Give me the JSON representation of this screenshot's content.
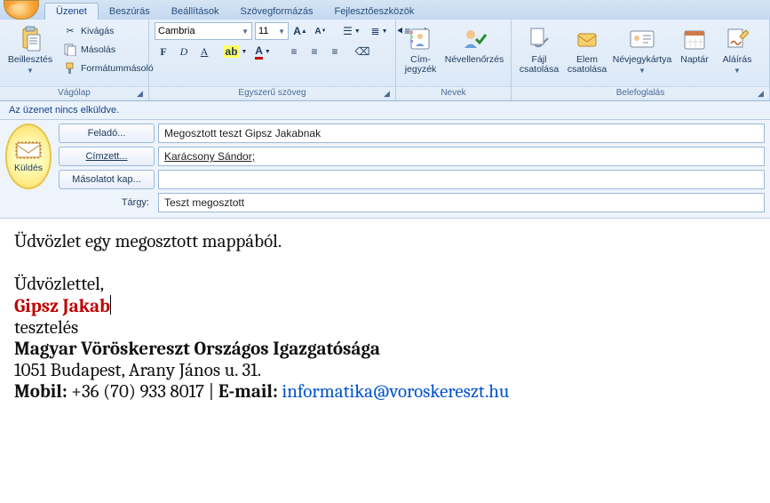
{
  "tabs": {
    "message": "Üzenet",
    "insert": "Beszúrás",
    "options": "Beállítások",
    "format": "Szövegformázás",
    "developer": "Fejlesztőeszközök"
  },
  "ribbon": {
    "clipboard": {
      "title": "Vágólap",
      "paste": "Beillesztés",
      "cut": "Kivágás",
      "copy": "Másolás",
      "format_painter": "Formátummásoló"
    },
    "basictext": {
      "title": "Egyszerű szöveg",
      "font_name": "Cambria",
      "font_size": "11"
    },
    "names": {
      "title": "Nevek",
      "address_book": "Cím-jegyzék",
      "check_names": "Névellenőrzés"
    },
    "include": {
      "title": "Belefoglalás",
      "attach_file": "Fájl csatolása",
      "attach_item": "Elem csatolása",
      "business_card": "Névjegykártya",
      "calendar": "Naptár",
      "signature": "Aláírás"
    }
  },
  "info_bar": "Az üzenet nincs elküldve.",
  "header": {
    "send": "Küldés",
    "from_btn": "Feladó...",
    "from_value": "Megosztott teszt Gipsz Jakabnak",
    "to_btn": "Címzett...",
    "to_value": "Karácsony Sándor;",
    "cc_btn": "Másolatot kap...",
    "cc_value": "",
    "subject_label": "Tárgy:",
    "subject_value": "Teszt megosztott"
  },
  "body": {
    "greeting": "Üdvözlet egy megosztott mappából.",
    "closing": "Üdvözlettel,",
    "sig_name": "Gipsz Jakab",
    "sig_role": "tesztelés",
    "sig_org": "Magyar Vöröskereszt  Országos Igazgatósága",
    "sig_addr": "1051 Budapest, Arany János u. 31.",
    "sig_mobile_label": "Mobil:",
    "sig_mobile": " +36 (70) 933 8017 | ",
    "sig_email_label": "E-mail:",
    "sig_email": " informatika@voroskereszt.hu"
  }
}
